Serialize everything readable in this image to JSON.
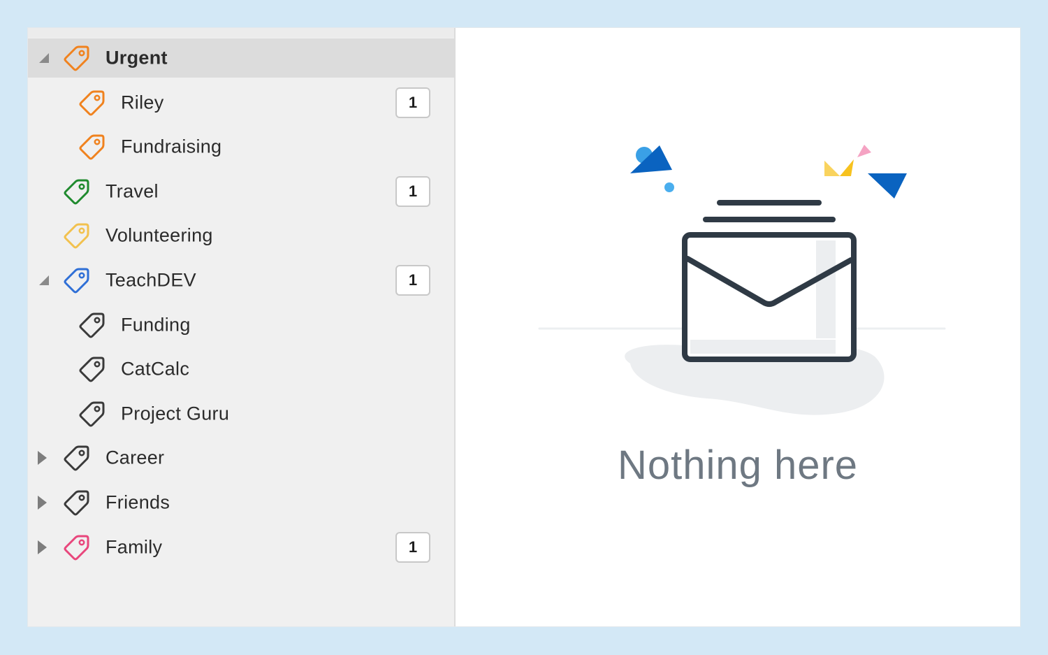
{
  "sidebar": {
    "items": [
      {
        "label": "Urgent",
        "color": "#f0821e",
        "indent": 0,
        "expander": "expanded",
        "count": null,
        "selected": true
      },
      {
        "label": "Riley",
        "color": "#f0821e",
        "indent": 1,
        "expander": "none",
        "count": "1",
        "selected": false
      },
      {
        "label": "Fundraising",
        "color": "#f0821e",
        "indent": 1,
        "expander": "none",
        "count": null,
        "selected": false
      },
      {
        "label": "Travel",
        "color": "#1f8a2e",
        "indent": 0,
        "expander": "none",
        "count": "1",
        "selected": false
      },
      {
        "label": "Volunteering",
        "color": "#f2c14e",
        "indent": 0,
        "expander": "none",
        "count": null,
        "selected": false
      },
      {
        "label": "TeachDEV",
        "color": "#2f6fd6",
        "indent": 0,
        "expander": "expanded",
        "count": "1",
        "selected": false
      },
      {
        "label": "Funding",
        "color": "#3a3a3a",
        "indent": 1,
        "expander": "none",
        "count": null,
        "selected": false
      },
      {
        "label": "CatCalc",
        "color": "#3a3a3a",
        "indent": 1,
        "expander": "none",
        "count": null,
        "selected": false
      },
      {
        "label": "Project Guru",
        "color": "#3a3a3a",
        "indent": 1,
        "expander": "none",
        "count": null,
        "selected": false
      },
      {
        "label": "Career",
        "color": "#3a3a3a",
        "indent": 0,
        "expander": "collapsed",
        "count": null,
        "selected": false
      },
      {
        "label": "Friends",
        "color": "#3a3a3a",
        "indent": 0,
        "expander": "collapsed",
        "count": null,
        "selected": false
      },
      {
        "label": "Family",
        "color": "#e8467c",
        "indent": 0,
        "expander": "collapsed",
        "count": "1",
        "selected": false
      }
    ]
  },
  "main": {
    "empty_state_text": "Nothing here",
    "illustration_icon": "envelope-empty-icon"
  }
}
